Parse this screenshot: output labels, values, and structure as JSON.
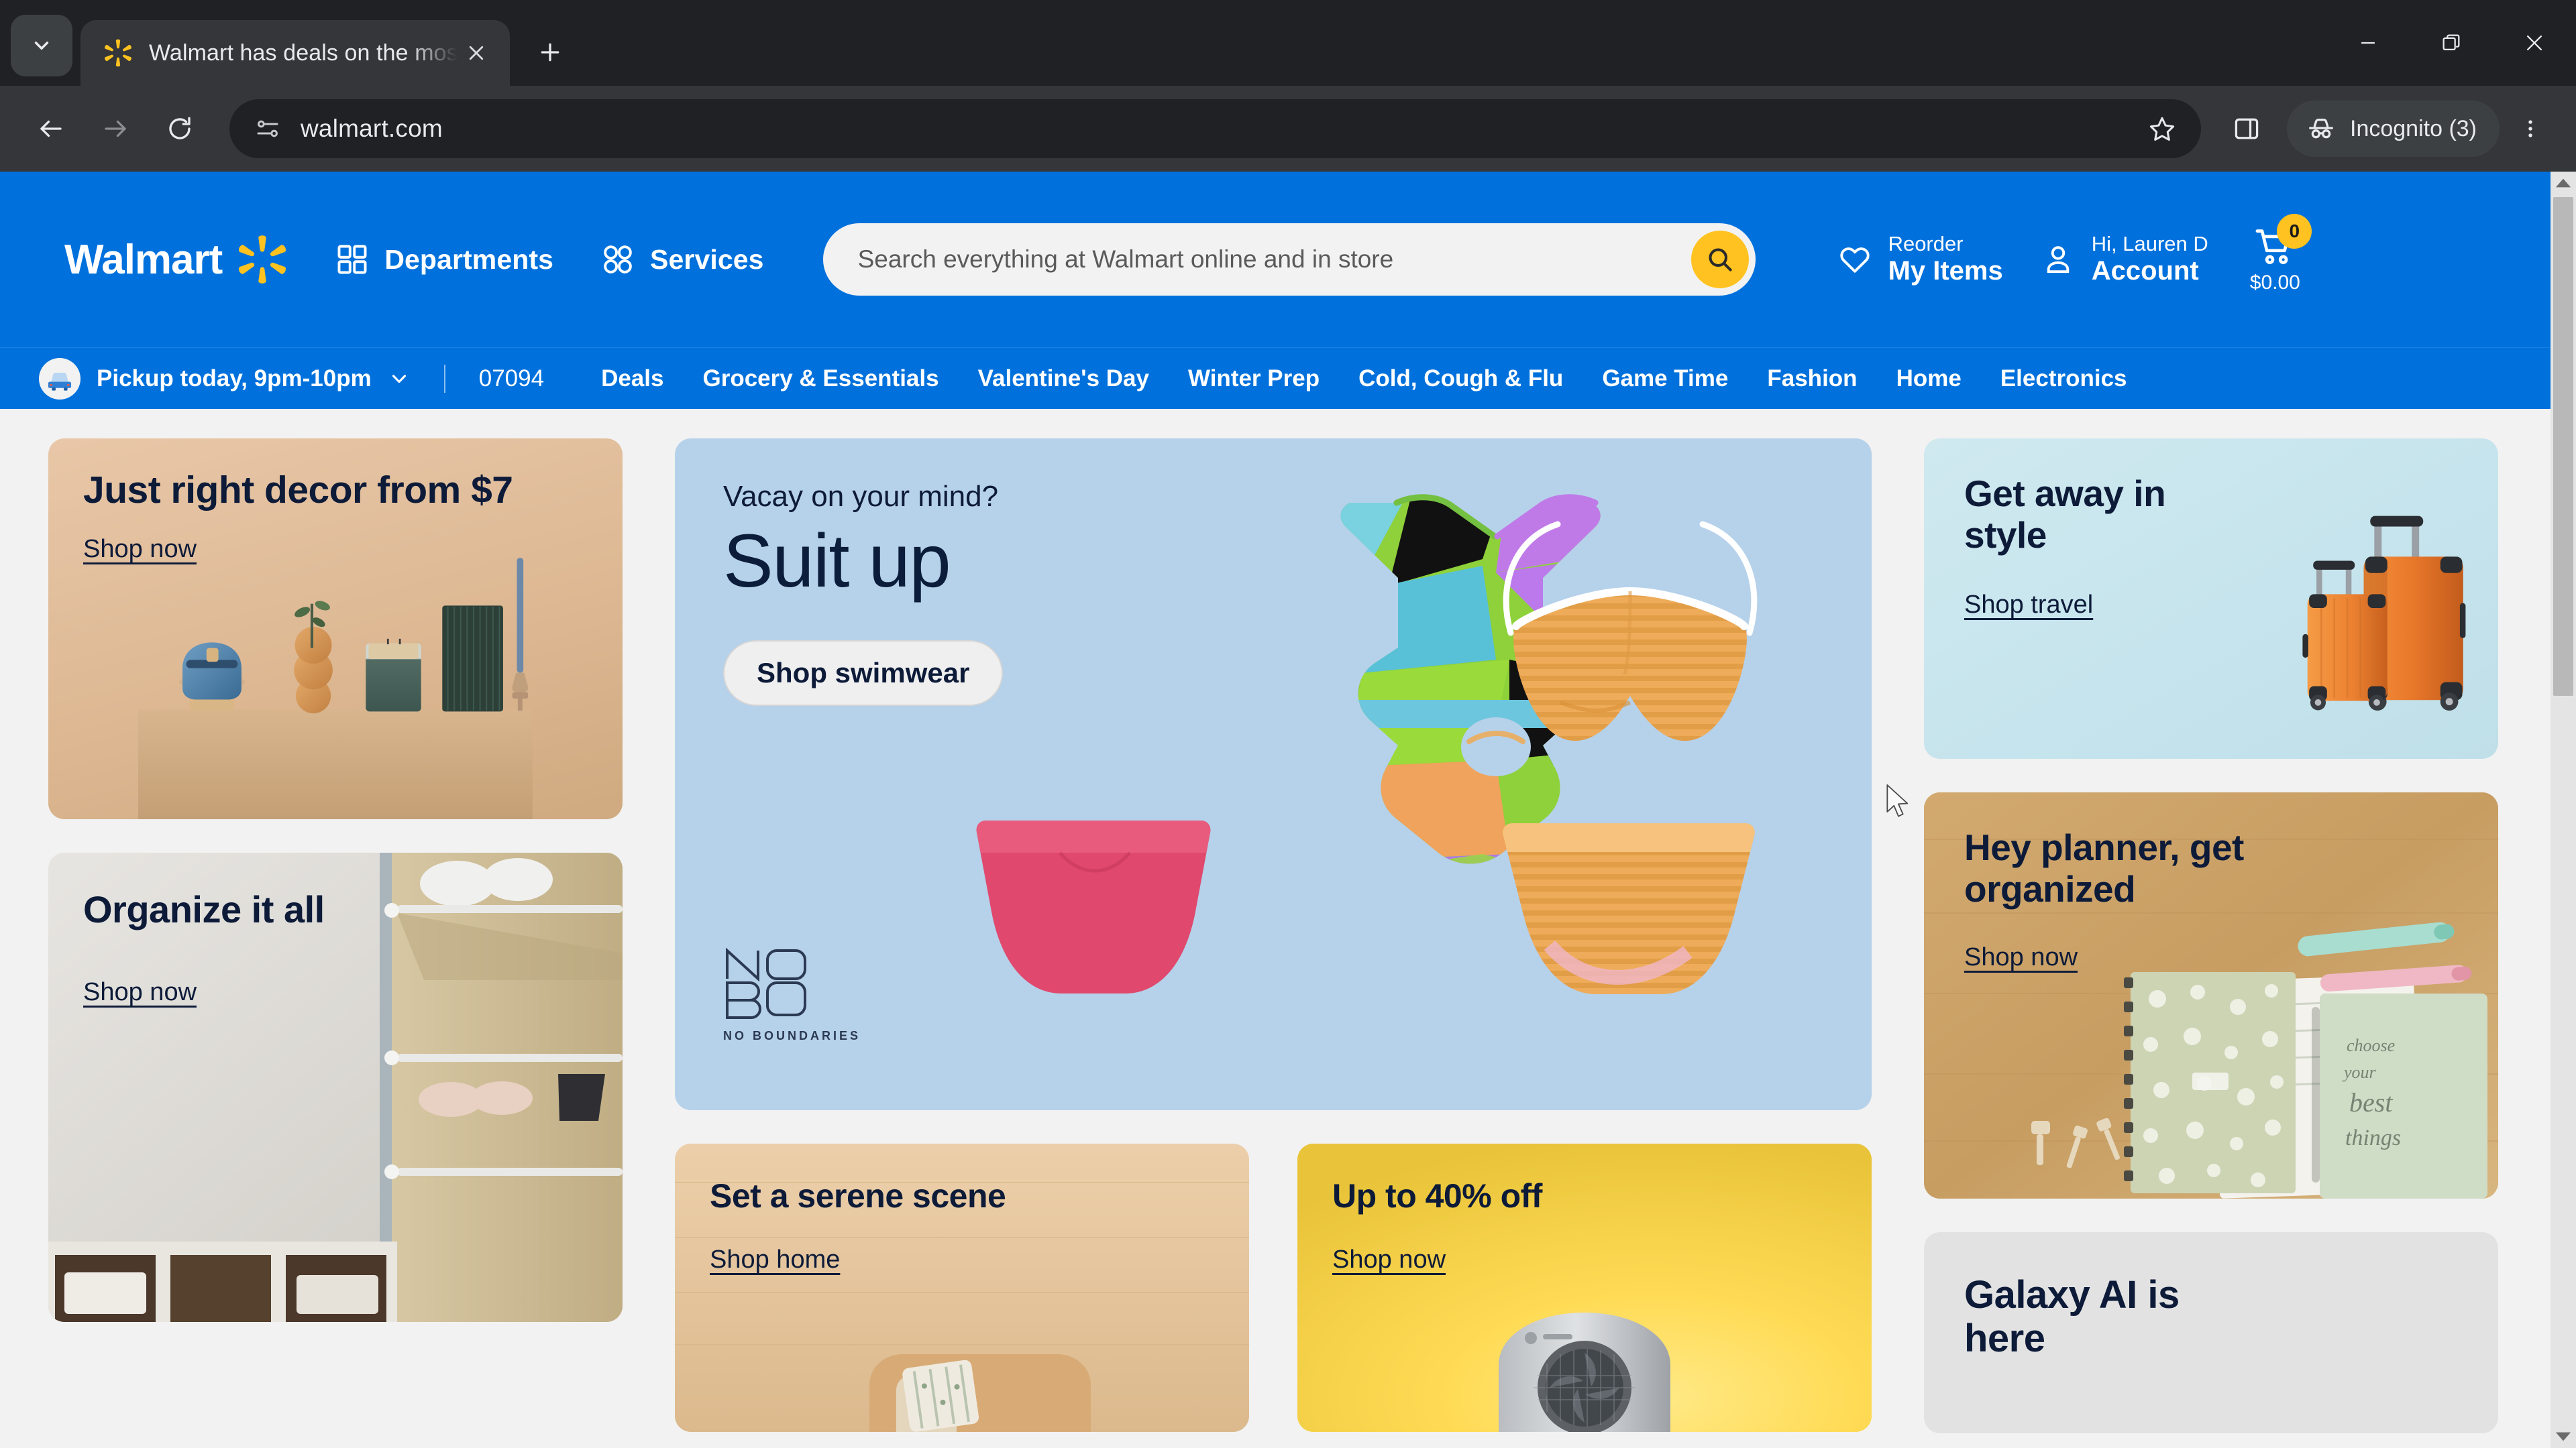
{
  "browser": {
    "tab": {
      "title": "Walmart has deals on the most",
      "favicon_icon": "walmart-spark-icon",
      "close_icon": "close-icon"
    },
    "tab_list_icon": "chevron-down-icon",
    "new_tab_icon": "plus-icon",
    "window_controls": {
      "minimize_icon": "minimize-icon",
      "restore_icon": "restore-icon",
      "close_icon": "close-icon"
    },
    "toolbar": {
      "back_icon": "arrow-left-icon",
      "forward_icon": "arrow-right-icon",
      "reload_icon": "reload-icon",
      "site_info_icon": "tune-settings-icon",
      "url": "walmart.com",
      "bookmark_icon": "star-icon",
      "side_panel_icon": "side-panel-icon",
      "incognito_icon": "incognito-hat-icon",
      "incognito_label": "Incognito (3)",
      "menu_icon": "kebab-menu-icon"
    }
  },
  "site": {
    "header": {
      "logo_text": "Walmart",
      "logo_icon": "walmart-spark-icon",
      "departments": {
        "label": "Departments",
        "icon": "grid-squares-icon"
      },
      "services": {
        "label": "Services",
        "icon": "four-circles-icon"
      },
      "search": {
        "placeholder": "Search everything at Walmart online and in store",
        "value": "",
        "submit_icon": "search-icon"
      },
      "reorder": {
        "top": "Reorder",
        "bottom": "My Items",
        "icon": "heart-icon"
      },
      "account": {
        "top": "Hi, Lauren D",
        "bottom": "Account",
        "icon": "person-icon"
      },
      "cart": {
        "count": "0",
        "total": "$0.00",
        "icon": "cart-icon"
      }
    },
    "subnav": {
      "pickup_label": "Pickup today, 9pm-10pm",
      "pickup_icon": "car-pickup-icon",
      "pickup_chevron_icon": "chevron-down-icon",
      "zip": "07094",
      "categories": [
        "Deals",
        "Grocery & Essentials",
        "Valentine's Day",
        "Winter Prep",
        "Cold, Cough & Flu",
        "Game Time",
        "Fashion",
        "Home",
        "Electronics"
      ]
    },
    "cards": {
      "decor": {
        "title": "Just right decor from $7",
        "link": "Shop now"
      },
      "organize": {
        "title": "Organize it all",
        "link": "Shop now"
      },
      "hero": {
        "eyebrow": "Vacay on your mind?",
        "headline": "Suit up",
        "button": "Shop swimwear",
        "brand_mark": "NOBO",
        "brand_tagline": "NO BOUNDARIES"
      },
      "serene": {
        "title": "Set a serene scene",
        "link": "Shop home"
      },
      "sale": {
        "title": "Up to 40% off",
        "link": "Shop now"
      },
      "travel": {
        "title": "Get away in style",
        "link": "Shop travel"
      },
      "planner": {
        "title": "Hey planner, get organized",
        "link": "Shop now"
      },
      "galaxy": {
        "title": "Galaxy AI is here"
      }
    },
    "colors": {
      "brand_blue": "#0071dc",
      "brand_yellow": "#ffc220",
      "ink": "#0d1b39",
      "page_bg": "#f2f2f2"
    }
  }
}
